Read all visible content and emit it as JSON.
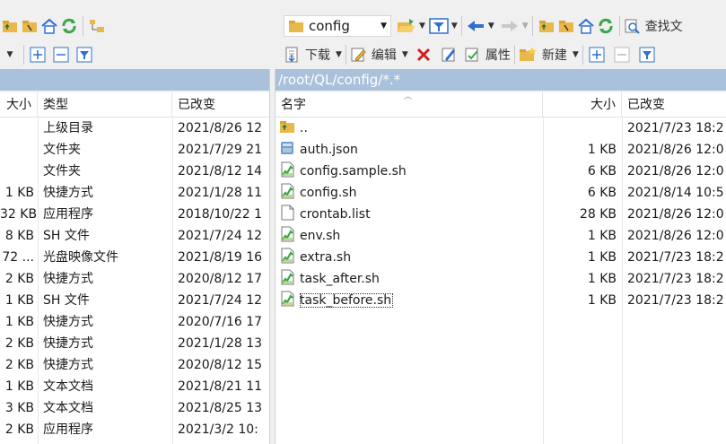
{
  "left": {
    "columns": {
      "size": "大小",
      "type": "类型",
      "modified": "已改变"
    },
    "rows": [
      {
        "size": "",
        "type": "上级目录",
        "modified": "2021/8/26  12"
      },
      {
        "size": "",
        "type": "文件夹",
        "modified": "2021/7/29  21"
      },
      {
        "size": "",
        "type": "文件夹",
        "modified": "2021/8/12  14"
      },
      {
        "size": "1 KB",
        "type": "快捷方式",
        "modified": "2021/1/28  11"
      },
      {
        "size": "32 KB",
        "type": "应用程序",
        "modified": "2018/10/22  1"
      },
      {
        "size": "8 KB",
        "type": "SH 文件",
        "modified": "2021/7/24  12"
      },
      {
        "size": "72 ...",
        "type": "光盘映像文件",
        "modified": "2021/8/19  16"
      },
      {
        "size": "2 KB",
        "type": "快捷方式",
        "modified": "2020/8/12  17"
      },
      {
        "size": "1 KB",
        "type": "SH 文件",
        "modified": "2021/7/24  12"
      },
      {
        "size": "1 KB",
        "type": "快捷方式",
        "modified": "2020/7/16  17"
      },
      {
        "size": "2 KB",
        "type": "快捷方式",
        "modified": "2021/1/28  13"
      },
      {
        "size": "2 KB",
        "type": "快捷方式",
        "modified": "2020/8/12  15"
      },
      {
        "size": "1 KB",
        "type": "文本文档",
        "modified": "2021/8/21  11"
      },
      {
        "size": "3 KB",
        "type": "文本文档",
        "modified": "2021/8/25  13"
      },
      {
        "size": "2 KB",
        "type": "应用程序",
        "modified": "2021/3/2  10:"
      }
    ]
  },
  "right": {
    "path": "/root/QL/config/*.*",
    "location": "config",
    "toolbar": {
      "download": "下载",
      "edit": "编辑",
      "properties": "属性",
      "new": "新建",
      "find": "查找文"
    },
    "columns": {
      "name": "名字",
      "size": "大小",
      "modified": "已改变"
    },
    "files": [
      {
        "name": "..",
        "size": "",
        "modified": "2021/7/23  18:2",
        "icon": "parent-folder-icon"
      },
      {
        "name": "auth.json",
        "size": "1 KB",
        "modified": "2021/8/26  12:0",
        "icon": "json-file-icon"
      },
      {
        "name": "config.sample.sh",
        "size": "6 KB",
        "modified": "2021/8/26  12:0",
        "icon": "sh-file-icon"
      },
      {
        "name": "config.sh",
        "size": "6 KB",
        "modified": "2021/8/14  10:5",
        "icon": "sh-file-icon"
      },
      {
        "name": "crontab.list",
        "size": "28 KB",
        "modified": "2021/8/26  12:0",
        "icon": "text-file-icon"
      },
      {
        "name": "env.sh",
        "size": "1 KB",
        "modified": "2021/8/26  12:0",
        "icon": "sh-file-icon"
      },
      {
        "name": "extra.sh",
        "size": "1 KB",
        "modified": "2021/7/23  18:2",
        "icon": "sh-file-icon"
      },
      {
        "name": "task_after.sh",
        "size": "1 KB",
        "modified": "2021/7/23  18:2",
        "icon": "sh-file-icon"
      },
      {
        "name": "task_before.sh",
        "size": "1 KB",
        "modified": "2021/7/23  18:2",
        "icon": "sh-file-icon"
      }
    ]
  },
  "colors": {
    "pathbar": "#a9c1da",
    "folder": "#e8b84a",
    "accent_green": "#3aa64a",
    "accent_blue": "#2f6fd0",
    "delete_red": "#d12020"
  }
}
